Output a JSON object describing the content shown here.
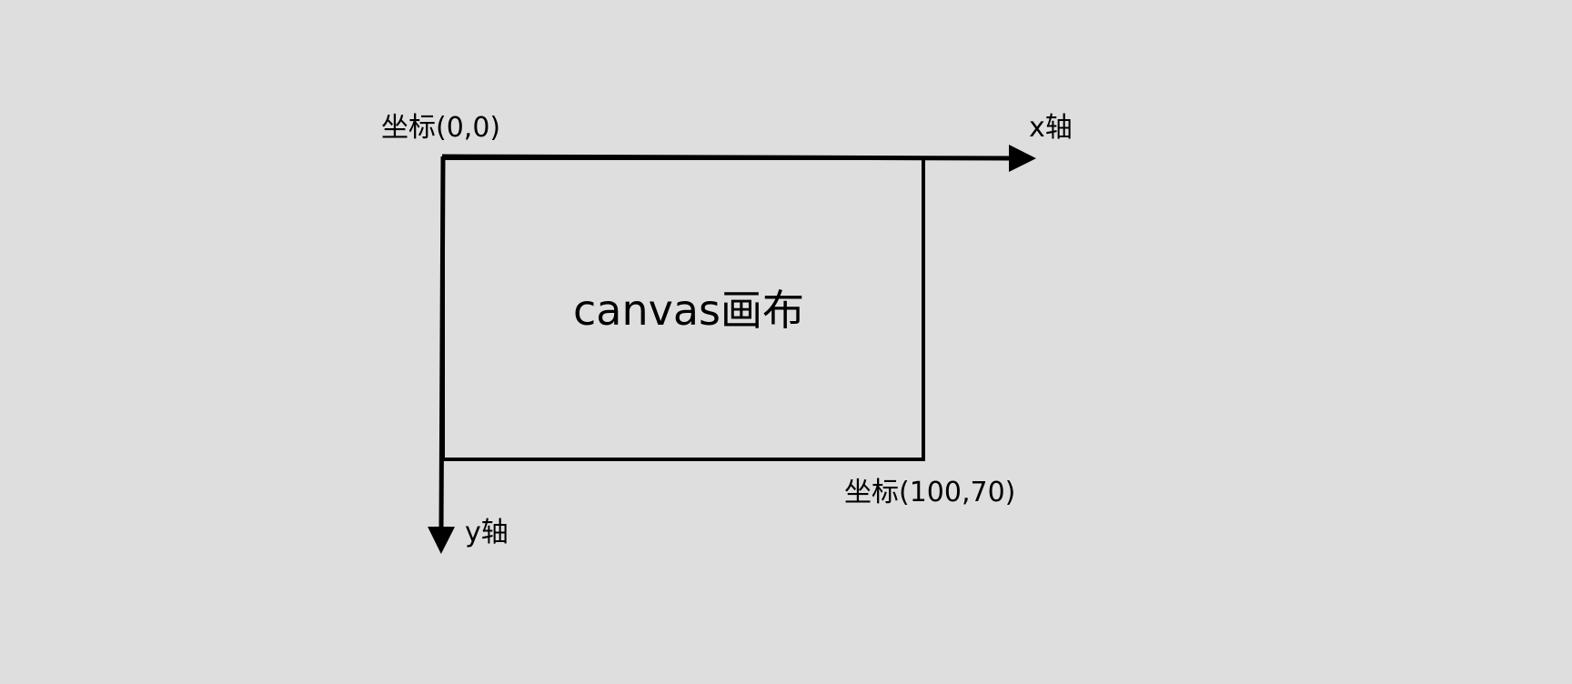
{
  "diagram": {
    "origin_label": "坐标(0,0)",
    "x_axis_label": "x轴",
    "y_axis_label": "y轴",
    "canvas_label": "canvas画布",
    "corner_label": "坐标(100,70)",
    "stroke_color": "#000000",
    "background_color": "#dedede"
  }
}
